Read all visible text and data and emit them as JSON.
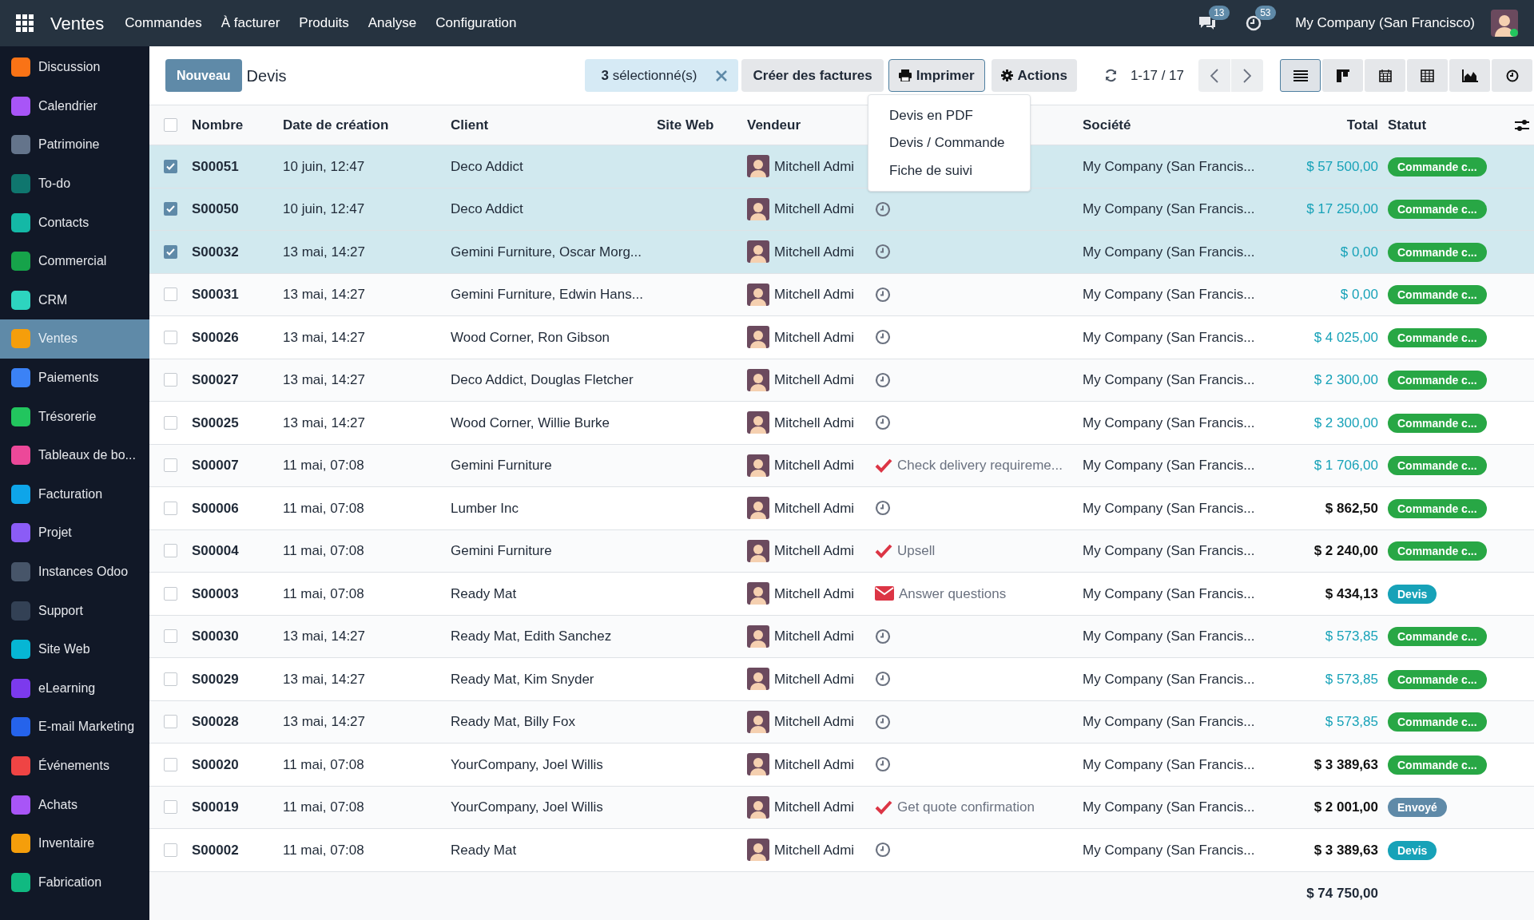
{
  "topbar": {
    "app": "Ventes",
    "menu": [
      "Commandes",
      "À facturer",
      "Produits",
      "Analyse",
      "Configuration"
    ],
    "messages_count": "13",
    "activities_count": "53",
    "company": "My Company (San Francisco)"
  },
  "sidebar": {
    "items": [
      {
        "label": "Discussion",
        "color": "#f97316",
        "selected": false
      },
      {
        "label": "Calendrier",
        "color": "#a855f7",
        "selected": false
      },
      {
        "label": "Patrimoine",
        "color": "#64748b",
        "selected": false
      },
      {
        "label": "To-do",
        "color": "#0f766e",
        "selected": false
      },
      {
        "label": "Contacts",
        "color": "#14b8a6",
        "selected": false
      },
      {
        "label": "Commercial",
        "color": "#16a34a",
        "selected": false
      },
      {
        "label": "CRM",
        "color": "#2dd4bf",
        "selected": false
      },
      {
        "label": "Ventes",
        "color": "#f59e0b",
        "selected": true
      },
      {
        "label": "Paiements",
        "color": "#3b82f6",
        "selected": false
      },
      {
        "label": "Trésorerie",
        "color": "#22c55e",
        "selected": false
      },
      {
        "label": "Tableaux de bo...",
        "color": "#ec4899",
        "selected": false
      },
      {
        "label": "Facturation",
        "color": "#0ea5e9",
        "selected": false
      },
      {
        "label": "Projet",
        "color": "#8b5cf6",
        "selected": false
      },
      {
        "label": "Instances Odoo",
        "color": "#475569",
        "selected": false
      },
      {
        "label": "Support",
        "color": "#334155",
        "selected": false
      },
      {
        "label": "Site Web",
        "color": "#06b6d4",
        "selected": false
      },
      {
        "label": "eLearning",
        "color": "#7c3aed",
        "selected": false
      },
      {
        "label": "E-mail Marketing",
        "color": "#2563eb",
        "selected": false
      },
      {
        "label": "Événements",
        "color": "#ef4444",
        "selected": false
      },
      {
        "label": "Achats",
        "color": "#a855f7",
        "selected": false
      },
      {
        "label": "Inventaire",
        "color": "#f59e0b",
        "selected": false
      },
      {
        "label": "Fabrication",
        "color": "#10b981",
        "selected": false
      }
    ]
  },
  "control_panel": {
    "new_button": "Nouveau",
    "title": "Devis",
    "selection_count": "3",
    "selection_label": "sélectionné(s)",
    "create_invoices": "Créer des factures",
    "print": "Imprimer",
    "actions": "Actions",
    "pager": "1-17 / 17",
    "views": [
      {
        "kind": "list",
        "selected": true
      },
      {
        "kind": "kanban",
        "selected": false
      },
      {
        "kind": "calendar",
        "selected": false
      },
      {
        "kind": "pivot",
        "selected": false
      },
      {
        "kind": "graph",
        "selected": false
      },
      {
        "kind": "activity",
        "selected": false
      }
    ]
  },
  "print_menu": [
    "Devis en PDF",
    "Devis / Commande",
    "Fiche de suivi"
  ],
  "table": {
    "columns": [
      "Nombre",
      "Date de création",
      "Client",
      "Site Web",
      "Vendeur",
      "Société",
      "Total",
      "Statut"
    ],
    "all_selected": false,
    "rows": [
      {
        "number": "S00051",
        "date": "10 juin, 12:47",
        "client": "Deco Addict",
        "salesperson": "Mitchell Admi",
        "activity": {
          "kind": "none"
        },
        "company": "My Company (San Francis...",
        "total": "$ 57 500,00",
        "to_invoice": true,
        "status": {
          "label": "Commande c...",
          "color": "#28a745"
        },
        "selected": true
      },
      {
        "number": "S00050",
        "date": "10 juin, 12:47",
        "client": "Deco Addict",
        "salesperson": "Mitchell Admi",
        "activity": {
          "kind": "clock"
        },
        "company": "My Company (San Francis...",
        "total": "$ 17 250,00",
        "to_invoice": true,
        "status": {
          "label": "Commande c...",
          "color": "#28a745"
        },
        "selected": true
      },
      {
        "number": "S00032",
        "date": "13 mai, 14:27",
        "client": "Gemini Furniture, Oscar Morg...",
        "salesperson": "Mitchell Admi",
        "activity": {
          "kind": "clock"
        },
        "company": "My Company (San Francis...",
        "total": "$ 0,00",
        "to_invoice": true,
        "status": {
          "label": "Commande c...",
          "color": "#28a745"
        },
        "selected": true
      },
      {
        "number": "S00031",
        "date": "13 mai, 14:27",
        "client": "Gemini Furniture, Edwin Hans...",
        "salesperson": "Mitchell Admi",
        "activity": {
          "kind": "clock"
        },
        "company": "My Company (San Francis...",
        "total": "$ 0,00",
        "to_invoice": true,
        "status": {
          "label": "Commande c...",
          "color": "#28a745"
        },
        "selected": false
      },
      {
        "number": "S00026",
        "date": "13 mai, 14:27",
        "client": "Wood Corner, Ron Gibson",
        "salesperson": "Mitchell Admi",
        "activity": {
          "kind": "clock"
        },
        "company": "My Company (San Francis...",
        "total": "$ 4 025,00",
        "to_invoice": true,
        "status": {
          "label": "Commande c...",
          "color": "#28a745"
        },
        "selected": false
      },
      {
        "number": "S00027",
        "date": "13 mai, 14:27",
        "client": "Deco Addict, Douglas Fletcher",
        "salesperson": "Mitchell Admi",
        "activity": {
          "kind": "clock"
        },
        "company": "My Company (San Francis...",
        "total": "$ 2 300,00",
        "to_invoice": true,
        "status": {
          "label": "Commande c...",
          "color": "#28a745"
        },
        "selected": false
      },
      {
        "number": "S00025",
        "date": "13 mai, 14:27",
        "client": "Wood Corner, Willie Burke",
        "salesperson": "Mitchell Admi",
        "activity": {
          "kind": "clock"
        },
        "company": "My Company (San Francis...",
        "total": "$ 2 300,00",
        "to_invoice": true,
        "status": {
          "label": "Commande c...",
          "color": "#28a745"
        },
        "selected": false
      },
      {
        "number": "S00007",
        "date": "11 mai, 07:08",
        "client": "Gemini Furniture",
        "salesperson": "Mitchell Admi",
        "activity": {
          "kind": "check",
          "text": "Check delivery requireme..."
        },
        "company": "My Company (San Francis...",
        "total": "$ 1 706,00",
        "to_invoice": true,
        "status": {
          "label": "Commande c...",
          "color": "#28a745"
        },
        "selected": false
      },
      {
        "number": "S00006",
        "date": "11 mai, 07:08",
        "client": "Lumber Inc",
        "salesperson": "Mitchell Admi",
        "activity": {
          "kind": "clock"
        },
        "company": "My Company (San Francis...",
        "total": "$ 862,50",
        "to_invoice": false,
        "status": {
          "label": "Commande c...",
          "color": "#28a745"
        },
        "selected": false
      },
      {
        "number": "S00004",
        "date": "11 mai, 07:08",
        "client": "Gemini Furniture",
        "salesperson": "Mitchell Admi",
        "activity": {
          "kind": "check",
          "text": "Upsell"
        },
        "company": "My Company (San Francis...",
        "total": "$ 2 240,00",
        "to_invoice": false,
        "status": {
          "label": "Commande c...",
          "color": "#28a745"
        },
        "selected": false
      },
      {
        "number": "S00003",
        "date": "11 mai, 07:08",
        "client": "Ready Mat",
        "salesperson": "Mitchell Admi",
        "activity": {
          "kind": "mail",
          "text": "Answer questions"
        },
        "company": "My Company (San Francis...",
        "total": "$ 434,13",
        "to_invoice": false,
        "status": {
          "label": "Devis",
          "color": "#17a2b8"
        },
        "selected": false
      },
      {
        "number": "S00030",
        "date": "13 mai, 14:27",
        "client": "Ready Mat, Edith Sanchez",
        "salesperson": "Mitchell Admi",
        "activity": {
          "kind": "clock"
        },
        "company": "My Company (San Francis...",
        "total": "$ 573,85",
        "to_invoice": true,
        "status": {
          "label": "Commande c...",
          "color": "#28a745"
        },
        "selected": false
      },
      {
        "number": "S00029",
        "date": "13 mai, 14:27",
        "client": "Ready Mat, Kim Snyder",
        "salesperson": "Mitchell Admi",
        "activity": {
          "kind": "clock"
        },
        "company": "My Company (San Francis...",
        "total": "$ 573,85",
        "to_invoice": true,
        "status": {
          "label": "Commande c...",
          "color": "#28a745"
        },
        "selected": false
      },
      {
        "number": "S00028",
        "date": "13 mai, 14:27",
        "client": "Ready Mat, Billy Fox",
        "salesperson": "Mitchell Admi",
        "activity": {
          "kind": "clock"
        },
        "company": "My Company (San Francis...",
        "total": "$ 573,85",
        "to_invoice": true,
        "status": {
          "label": "Commande c...",
          "color": "#28a745"
        },
        "selected": false
      },
      {
        "number": "S00020",
        "date": "11 mai, 07:08",
        "client": "YourCompany, Joel Willis",
        "salesperson": "Mitchell Admi",
        "activity": {
          "kind": "clock"
        },
        "company": "My Company (San Francis...",
        "total": "$ 3 389,63",
        "to_invoice": false,
        "status": {
          "label": "Commande c...",
          "color": "#28a745"
        },
        "selected": false
      },
      {
        "number": "S00019",
        "date": "11 mai, 07:08",
        "client": "YourCompany, Joel Willis",
        "salesperson": "Mitchell Admi",
        "activity": {
          "kind": "check",
          "text": "Get quote confirmation"
        },
        "company": "My Company (San Francis...",
        "total": "$ 2 001,00",
        "to_invoice": false,
        "status": {
          "label": "Envoyé",
          "color": "#5f8aa8"
        },
        "selected": false
      },
      {
        "number": "S00002",
        "date": "11 mai, 07:08",
        "client": "Ready Mat",
        "salesperson": "Mitchell Admi",
        "activity": {
          "kind": "clock"
        },
        "company": "My Company (San Francis...",
        "total": "$ 3 389,63",
        "to_invoice": false,
        "status": {
          "label": "Devis",
          "color": "#17a2b8"
        },
        "selected": false
      }
    ],
    "footer_total": "$ 74 750,00"
  }
}
